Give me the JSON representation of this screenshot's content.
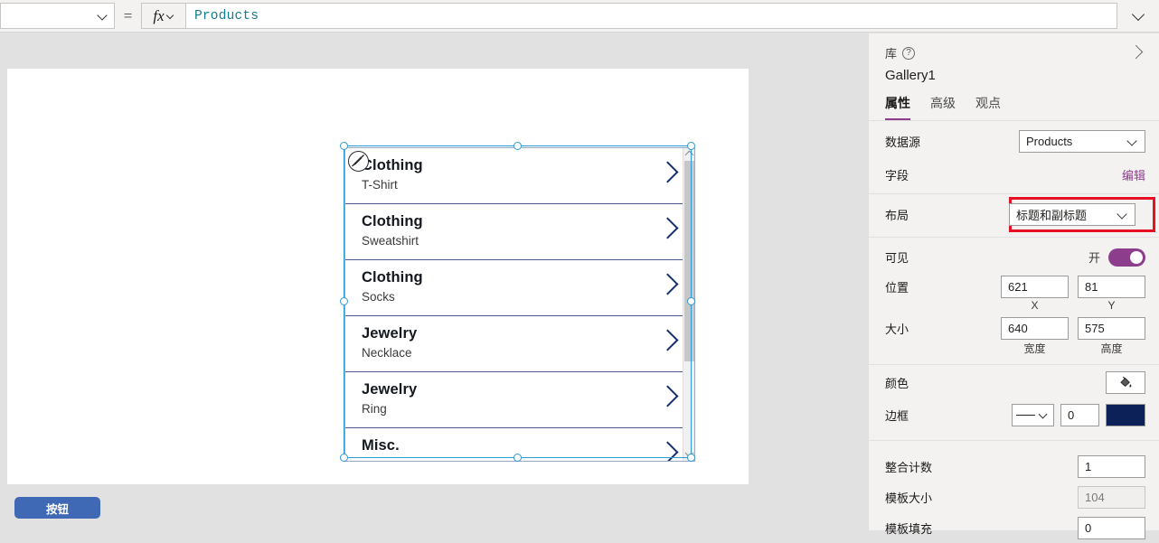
{
  "formula_bar": {
    "property_selector_value": "",
    "equals": "=",
    "fx_label": "fx",
    "formula_value": "Products"
  },
  "canvas": {
    "gallery": {
      "items": [
        {
          "title": "Clothing",
          "subtitle": "T-Shirt"
        },
        {
          "title": "Clothing",
          "subtitle": "Sweatshirt"
        },
        {
          "title": "Clothing",
          "subtitle": "Socks"
        },
        {
          "title": "Jewelry",
          "subtitle": "Necklace"
        },
        {
          "title": "Jewelry",
          "subtitle": "Ring"
        },
        {
          "title": "Misc.",
          "subtitle": ""
        }
      ]
    },
    "button_label": "按钮"
  },
  "right_panel": {
    "kicker": "库",
    "subject": "Gallery1",
    "tabs": [
      {
        "label": "属性",
        "active": true
      },
      {
        "label": "高级",
        "active": false
      },
      {
        "label": "观点",
        "active": false
      }
    ],
    "properties": {
      "data_source_label": "数据源",
      "data_source_value": "Products",
      "fields_label": "字段",
      "fields_edit_link": "编辑",
      "layout_label": "布局",
      "layout_value": "标题和副标题",
      "visible_label": "可见",
      "visible_state": "开",
      "position_label": "位置",
      "position_x": "621",
      "position_y": "81",
      "position_x_axis": "X",
      "position_y_axis": "Y",
      "size_label": "大小",
      "size_width": "640",
      "size_height": "575",
      "size_width_axis": "宽度",
      "size_height_axis": "高度",
      "color_label": "颜色",
      "border_label": "边框",
      "border_width": "0",
      "border_color_hex": "#0d2159",
      "snap_count_label": "整合计数",
      "snap_count_value": "1",
      "template_size_label": "模板大小",
      "template_size_value": "104",
      "template_padding_label": "模板填充",
      "template_padding_value": "0"
    },
    "highlight_color": "#e81123",
    "accent_color": "#8c3d8c"
  }
}
